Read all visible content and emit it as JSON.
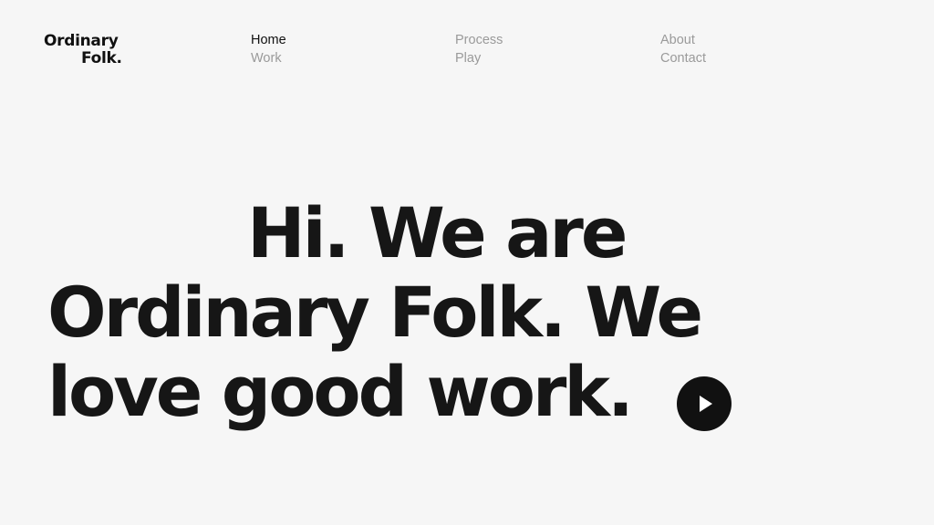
{
  "logo": {
    "line1": "Ordinary",
    "line2": "Folk."
  },
  "nav": {
    "items": [
      {
        "label": "Home",
        "active": true
      },
      {
        "label": "Work",
        "active": false
      },
      {
        "label": "Process",
        "active": false
      },
      {
        "label": "Play",
        "active": false
      },
      {
        "label": "About",
        "active": false
      },
      {
        "label": "Contact",
        "active": false
      }
    ]
  },
  "hero": {
    "line1": "Hi. We are",
    "line2": "Ordinary Folk. We",
    "line3": "love good work."
  },
  "play_button": {
    "icon": "play-icon"
  },
  "colors": {
    "background": "#f6f6f6",
    "text": "#111111",
    "nav_inactive": "#9a9a9a"
  }
}
